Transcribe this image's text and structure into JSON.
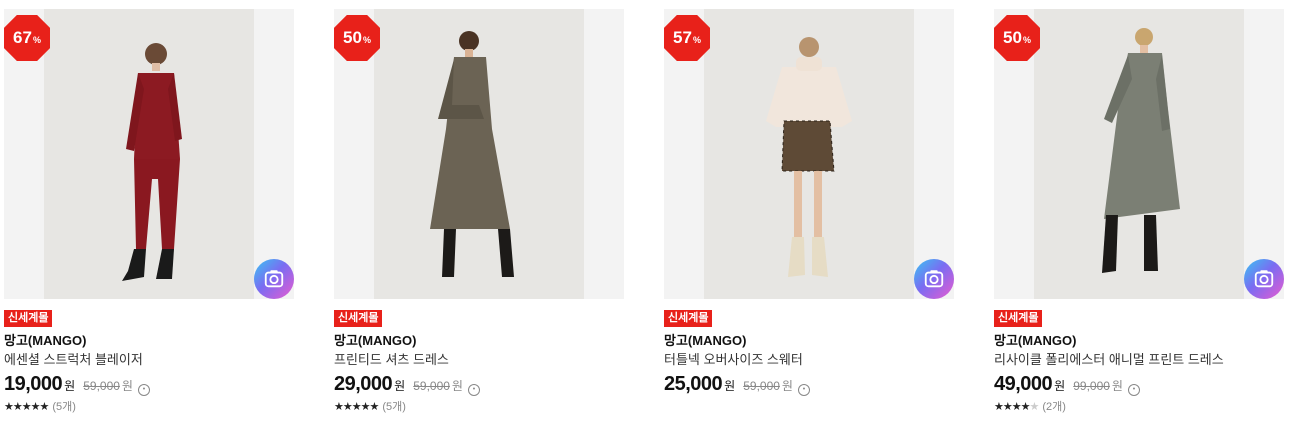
{
  "products": [
    {
      "discount": "67",
      "discount_unit": "%",
      "badge": "신세계몰",
      "brand": "망고(MANGO)",
      "name": "에센셜 스트럭처 블레이저",
      "price": "19,000",
      "won": "원",
      "original_price": "59,000",
      "original_won": "원",
      "stars": "★★★★★",
      "stars_empty": "",
      "rating_value": 5,
      "review_count": "(5개)",
      "colors": {
        "outfit": "#8c1a22",
        "bg": "#e6e6e4"
      }
    },
    {
      "discount": "50",
      "discount_unit": "%",
      "badge": "신세계몰",
      "brand": "망고(MANGO)",
      "name": "프린티드 셔츠 드레스",
      "price": "29,000",
      "won": "원",
      "original_price": "59,000",
      "original_won": "원",
      "stars": "★★★★★",
      "stars_empty": "",
      "rating_value": 5,
      "review_count": "(5개)",
      "colors": {
        "outfit": "#6b6354",
        "bg": "#e1dfdb"
      }
    },
    {
      "discount": "57",
      "discount_unit": "%",
      "badge": "신세계몰",
      "brand": "망고(MANGO)",
      "name": "터틀넥 오버사이즈 스웨터",
      "price": "25,000",
      "won": "원",
      "original_price": "59,000",
      "original_won": "원",
      "stars": "",
      "stars_empty": "",
      "rating_value": null,
      "review_count": "",
      "colors": {
        "outfit": "#f1e6dc",
        "bg": "#e9e8e5"
      }
    },
    {
      "discount": "50",
      "discount_unit": "%",
      "badge": "신세계몰",
      "brand": "망고(MANGO)",
      "name": "리사이클 폴리에스터 애니멀 프린트 드레스",
      "price": "49,000",
      "won": "원",
      "original_price": "99,000",
      "original_won": "원",
      "stars": "★★★★",
      "stars_empty": "★",
      "rating_value": 4,
      "review_count": "(2개)",
      "colors": {
        "outfit": "#7b7f74",
        "bg": "#e4e4e1"
      }
    }
  ],
  "icons": {
    "camera": "camera-icon",
    "info": "info-circle-icon"
  }
}
